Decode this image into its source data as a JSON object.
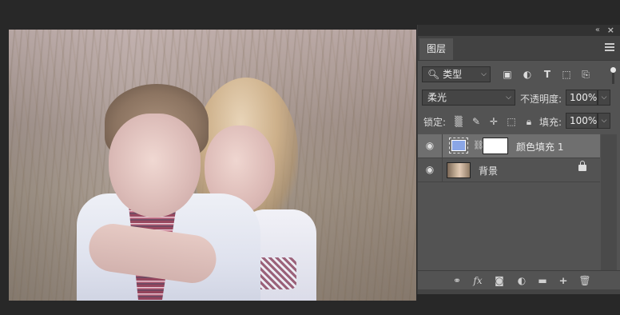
{
  "panel": {
    "tab_label": "图层",
    "collapse_glyph": "«",
    "close_glyph": "×",
    "menu_icon": "hamburger-menu-icon"
  },
  "filter": {
    "kind_label": "类型",
    "icons": [
      "image-filter-icon",
      "adjustment-filter-icon",
      "text-filter-icon",
      "shape-filter-icon",
      "smart-object-filter-icon"
    ]
  },
  "blend": {
    "mode": "柔光",
    "opacity_label": "不透明度:",
    "opacity_value": "100%"
  },
  "lock": {
    "label": "锁定:",
    "icons": [
      "lock-transparent-pixels-icon",
      "lock-image-pixels-icon",
      "lock-position-icon",
      "lock-artboard-icon",
      "lock-all-icon"
    ],
    "fill_label": "填充:",
    "fill_value": "100%"
  },
  "layers": [
    {
      "name": "颜色填充 1",
      "type": "solid-color-fill",
      "color": "#8aa6e6",
      "mask": "#ffffff",
      "visible": true,
      "selected": true
    },
    {
      "name": "背景",
      "type": "background",
      "visible": true,
      "locked": true,
      "selected": false
    }
  ],
  "bottom_icons": [
    "link-layers-icon",
    "fx-icon",
    "add-mask-icon",
    "adjustment-layer-icon",
    "new-group-icon",
    "new-layer-icon",
    "delete-icon"
  ]
}
